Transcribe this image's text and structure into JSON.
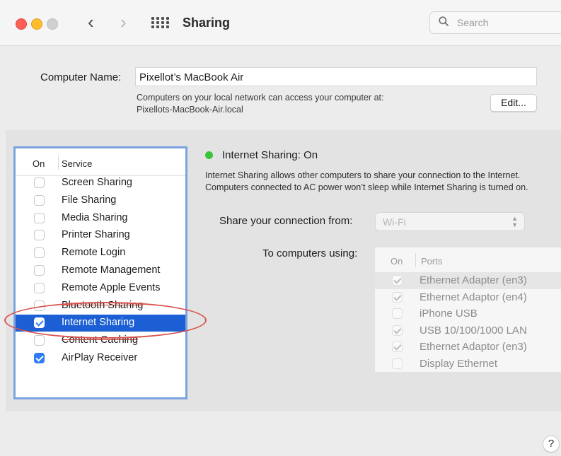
{
  "window": {
    "title": "Sharing",
    "back_glyph": "‹",
    "forward_glyph": "›",
    "search_placeholder": "Search"
  },
  "computer": {
    "name_label": "Computer Name:",
    "name_value": "Pixellot’s MacBook Air",
    "access_line1": "Computers on your local network can access your computer at:",
    "access_line2": "Pixellots-MacBook-Air.local",
    "edit_label": "Edit..."
  },
  "services": {
    "header_on": "On",
    "header_service": "Service",
    "items": [
      {
        "label": "Screen Sharing",
        "checked": false
      },
      {
        "label": "File Sharing",
        "checked": false
      },
      {
        "label": "Media Sharing",
        "checked": false
      },
      {
        "label": "Printer Sharing",
        "checked": false
      },
      {
        "label": "Remote Login",
        "checked": false
      },
      {
        "label": "Remote Management",
        "checked": false
      },
      {
        "label": "Remote Apple Events",
        "checked": false
      },
      {
        "label": "Bluetooth Sharing",
        "checked": false
      },
      {
        "label": "Internet Sharing",
        "checked": true,
        "selected": true
      },
      {
        "label": "Content Caching",
        "checked": false
      },
      {
        "label": "AirPlay Receiver",
        "checked": true
      }
    ]
  },
  "detail": {
    "status_title": "Internet Sharing: On",
    "status_color": "#3bc43a",
    "description": "Internet Sharing allows other computers to share your connection to the Internet. Computers connected to AC power won’t sleep while Internet Sharing is turned on.",
    "share_from_label": "Share your connection from:",
    "share_from_value": "Wi-Fi",
    "to_label": "To computers using:",
    "ports_header_on": "On",
    "ports_header_ports": "Ports",
    "ports": [
      {
        "label": "Ethernet Adapter (en3)",
        "checked": true
      },
      {
        "label": "Ethernet Adaptor (en4)",
        "checked": true
      },
      {
        "label": "iPhone USB",
        "checked": false
      },
      {
        "label": "USB 10/100/1000 LAN",
        "checked": true
      },
      {
        "label": "Ethernet Adaptor (en3)",
        "checked": true
      },
      {
        "label": "Display Ethernet",
        "checked": false
      }
    ]
  },
  "help_label": "?",
  "colors": {
    "accent": "#2f7cf6",
    "selection": "#1c5fd4",
    "annotation": "#d9534f",
    "list_outline": "#7ba3df"
  }
}
